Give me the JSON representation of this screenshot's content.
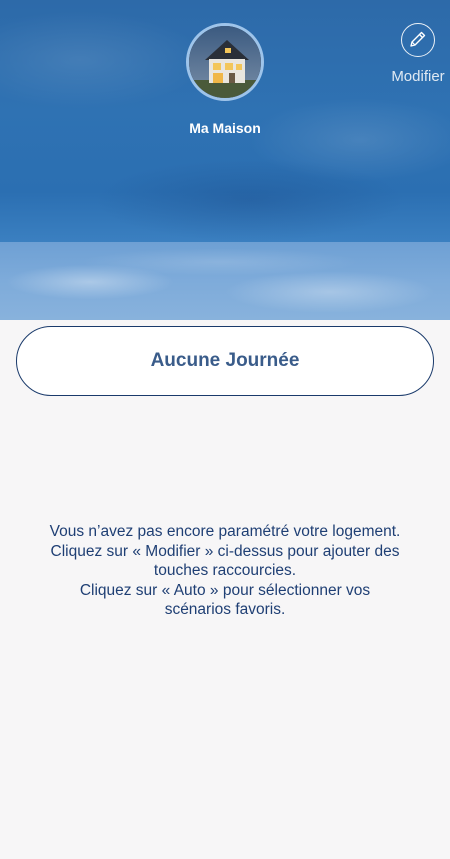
{
  "header": {
    "home_name": "Ma Maison",
    "edit_label": "Modifier",
    "edit_icon": "pencil-icon",
    "avatar_icon": "house-photo-avatar"
  },
  "main": {
    "day_button_label": "Aucune Journée",
    "message_lines": [
      "Vous n’avez pas encore paramétré votre logement.",
      "Cliquez sur « Modifier » ci-dessus pour ajouter des",
      "touches raccourcies.",
      "Cliquez sur « Auto » pour sélectionner vos",
      "scénarios favoris."
    ]
  },
  "colors": {
    "accent": "#1a3a6b",
    "button_text": "#3a5c8a",
    "message_text": "#1f3f74",
    "background": "#f7f6f7"
  }
}
